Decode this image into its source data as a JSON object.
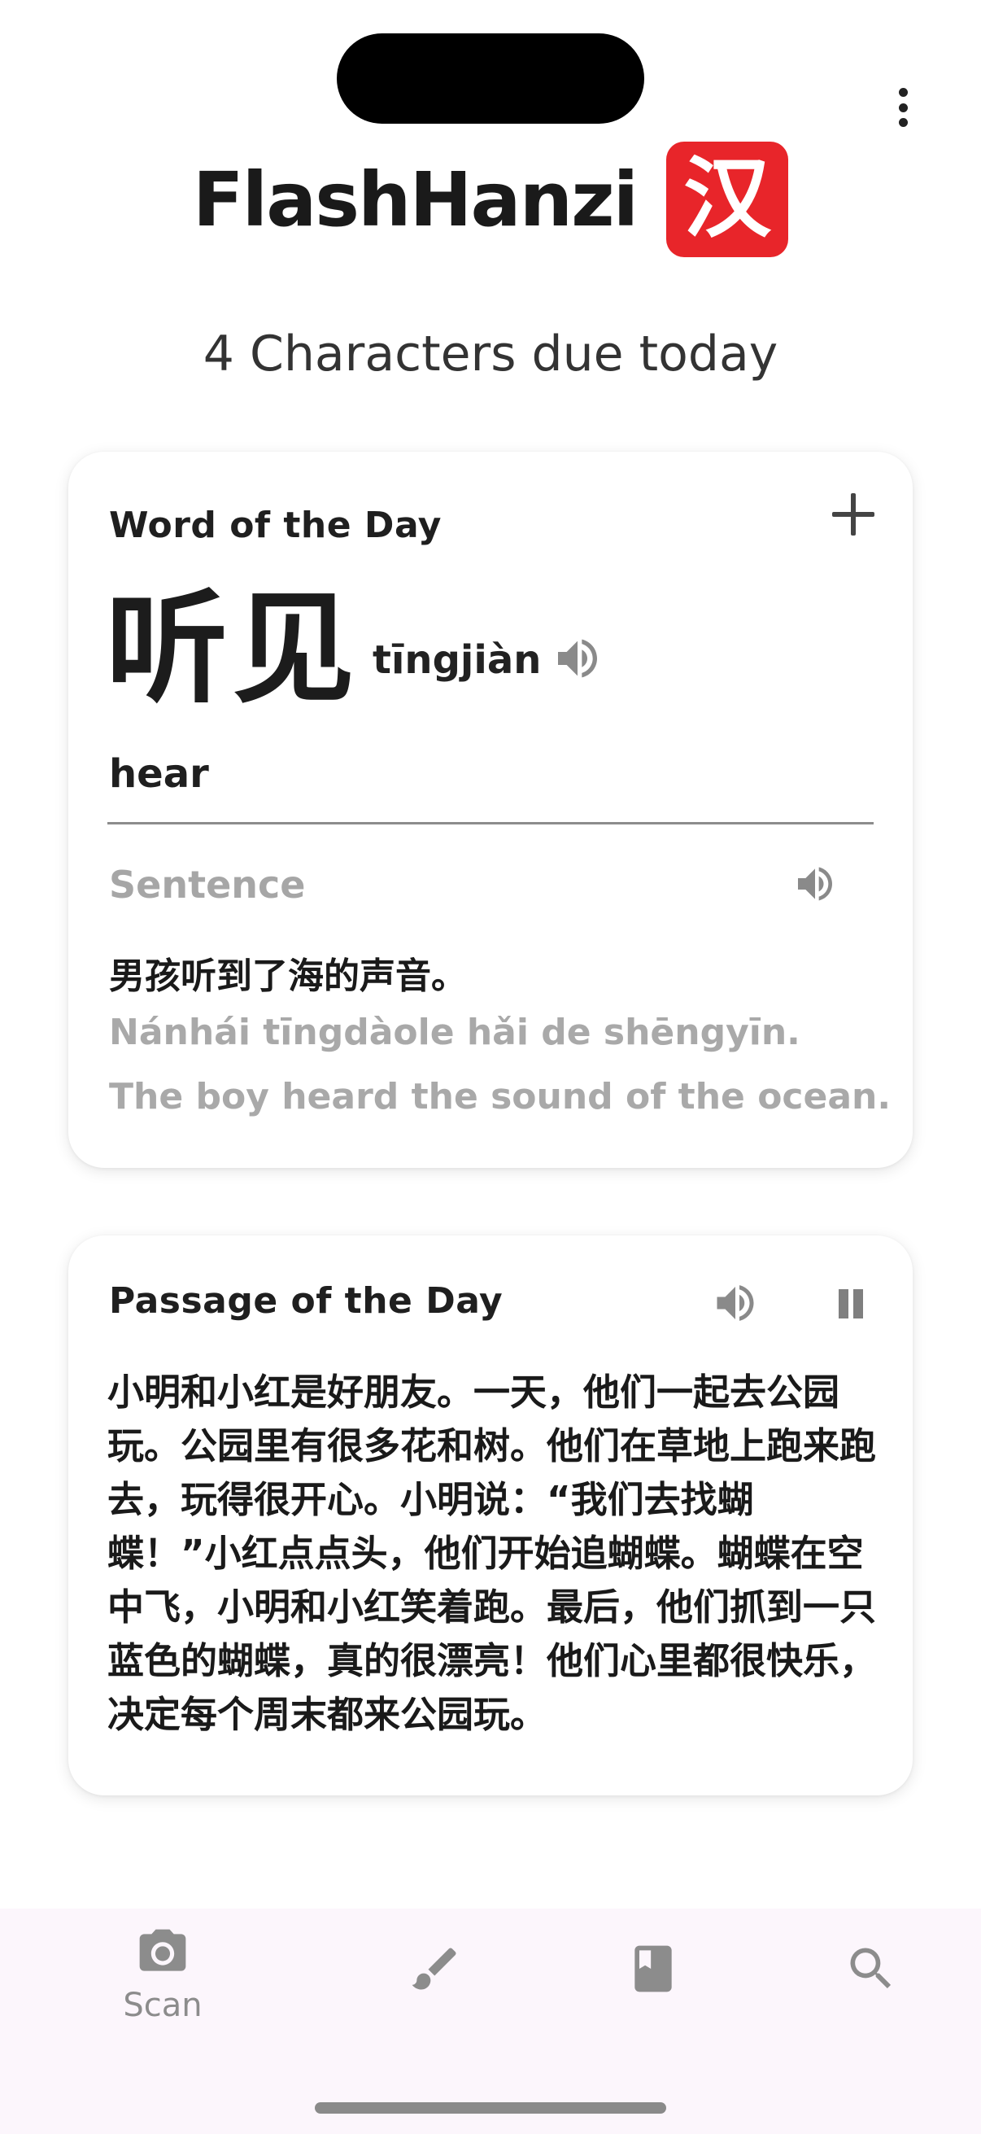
{
  "app": {
    "title": "FlashHanzi",
    "logo_char": "汉",
    "brand_color": "#e8252a",
    "due_text": "4 Characters due today"
  },
  "word_card": {
    "title": "Word of the Day",
    "add_icon": "plus-icon",
    "hanzi": "听见",
    "pinyin": "tīngjiàn",
    "meaning": "hear",
    "sentence_label": "Sentence",
    "sentence_zh": "男孩听到了海的声音。",
    "sentence_pinyin": "Nánhái tīngdàole hǎi de shēngyīn.",
    "sentence_en": "The boy heard the sound of the ocean."
  },
  "passage_card": {
    "title": "Passage of the Day",
    "play_icon": "speaker-icon",
    "pause_icon": "pause-icon",
    "text": "小明和小红是好朋友。一天，他们一起去公园玩。公园里有很多花和树。他们在草地上跑来跑去，玩得很开心。小明说：“我们去找蝴蝶！”小红点点头，他们开始追蝴蝶。蝴蝶在空中飞，小明和小红笑着跑。最后，他们抓到一只蓝色的蝴蝶，真的很漂亮！他们心里都很快乐，决定每个周末都来公园玩。"
  },
  "bottom_nav": {
    "items": [
      {
        "icon": "camera-icon",
        "label": "Scan"
      },
      {
        "icon": "brush-icon",
        "label": ""
      },
      {
        "icon": "book-icon",
        "label": ""
      },
      {
        "icon": "search-icon",
        "label": ""
      }
    ]
  }
}
